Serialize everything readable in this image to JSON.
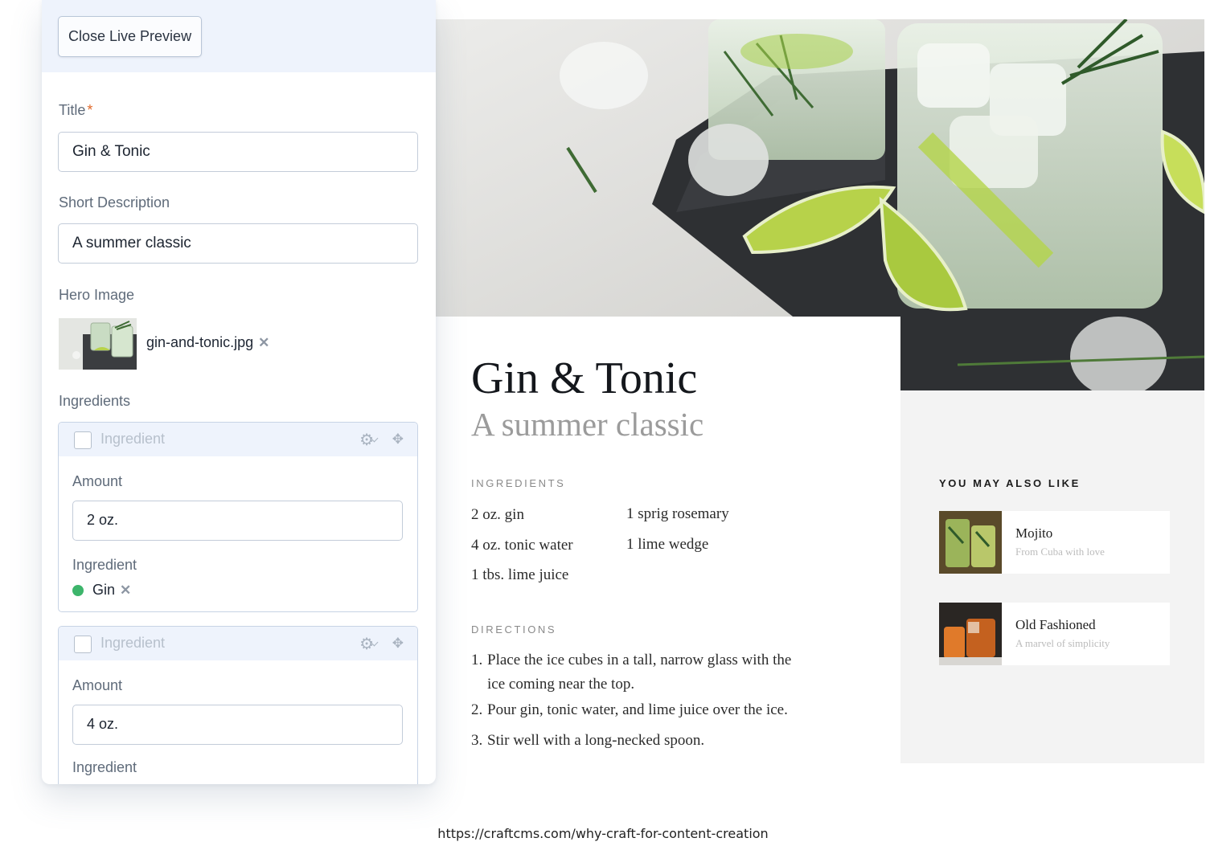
{
  "editor": {
    "close_button": "Close Live Preview",
    "title_label": "Title",
    "required_mark": "*",
    "title_value": "Gin & Tonic",
    "short_desc_label": "Short Description",
    "short_desc_value": "A summer classic",
    "hero_label": "Hero Image",
    "hero_filename": "gin-and-tonic.jpg",
    "ingredients_label": "Ingredients",
    "blocks": [
      {
        "type": "Ingredient",
        "amount_label": "Amount",
        "amount": "2 oz.",
        "ingredient_label": "Ingredient",
        "ingredient": "Gin"
      },
      {
        "type": "Ingredient",
        "amount_label": "Amount",
        "amount": "4 oz.",
        "ingredient_label": "Ingredient"
      }
    ],
    "colors": {
      "accent_required": "#e0692a",
      "status_green": "#3db56b",
      "header_bg": "#eef3fc"
    }
  },
  "preview": {
    "title": "Gin & Tonic",
    "subtitle": "A summer classic",
    "ingredients_heading": "INGREDIENTS",
    "ingredients": [
      "2 oz. gin",
      "4 oz. tonic water",
      "1 tbs. lime juice",
      "1 sprig rosemary",
      "1 lime wedge"
    ],
    "directions_heading": "DIRECTIONS",
    "directions": [
      {
        "num": "1.",
        "text": "Place the ice cubes in a tall, narrow glass with the ice coming near the top."
      },
      {
        "num": "2.",
        "text": "Pour gin, tonic water, and lime juice over the ice."
      },
      {
        "num": "3.",
        "text": "Stir well with a long-necked spoon."
      }
    ],
    "also_like_heading": "YOU MAY ALSO LIKE",
    "recommendations": [
      {
        "name": "Mojito",
        "desc": "From Cuba with love"
      },
      {
        "name": "Old Fashioned",
        "desc": "A marvel of simplicity"
      }
    ]
  },
  "footer_url": "https://craftcms.com/why-craft-for-content-creation"
}
